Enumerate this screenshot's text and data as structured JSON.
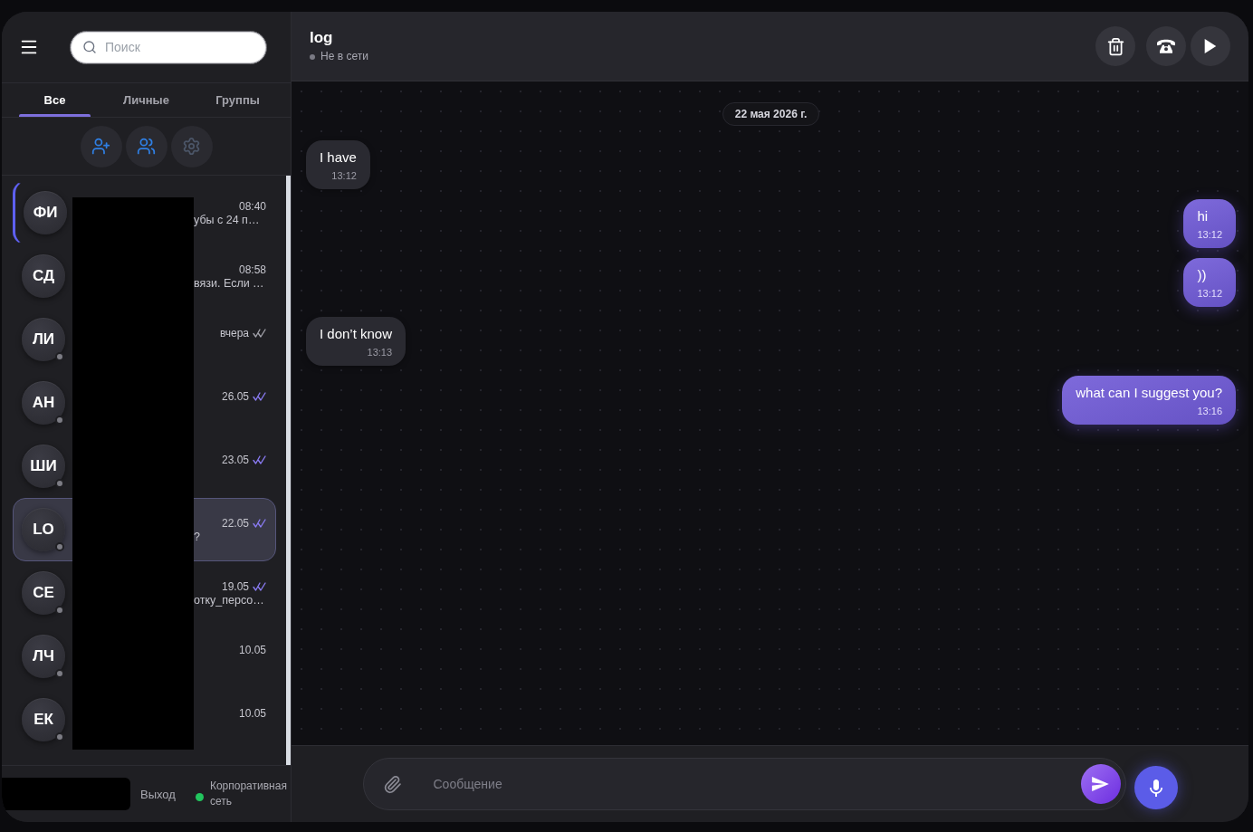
{
  "sidebar": {
    "search": {
      "placeholder": "Поиск"
    },
    "tabs": [
      {
        "label": "Все",
        "selected": true
      },
      {
        "label": "Личные",
        "selected": false
      },
      {
        "label": "Группы",
        "selected": false
      }
    ],
    "chats": [
      {
        "initials": "ФИ",
        "time": "08:40",
        "preview": "убы с 24 п…",
        "offline": false,
        "focused": true,
        "selected": false
      },
      {
        "initials": "СД",
        "time": "08:58",
        "preview": "вязи. Если …",
        "offline": false,
        "focused": false,
        "selected": false
      },
      {
        "initials": "ЛИ",
        "time": "вчера",
        "receipt": {
          "read": false
        },
        "offline": true,
        "focused": false,
        "selected": false
      },
      {
        "initials": "АН",
        "time": "26.05",
        "receipt": {
          "read": true
        },
        "offline": true,
        "focused": false,
        "selected": false
      },
      {
        "initials": "ШИ",
        "time": "23.05",
        "receipt": {
          "read": true
        },
        "offline": true,
        "focused": false,
        "selected": false
      },
      {
        "initials": "LO",
        "time": "22.05",
        "preview": "?",
        "receipt": {
          "read": true
        },
        "offline": true,
        "focused": false,
        "selected": true
      },
      {
        "initials": "СЕ",
        "time": "19.05",
        "preview": "отку_персо…",
        "receipt": {
          "read": true
        },
        "offline": true,
        "focused": false,
        "selected": false
      },
      {
        "initials": "ЛЧ",
        "time": "10.05",
        "offline": true,
        "focused": false,
        "selected": false
      },
      {
        "initials": "ЕК",
        "time": "10.05",
        "offline": true,
        "focused": false,
        "selected": false
      }
    ],
    "footer": {
      "logout": "Выход",
      "network": {
        "label": "Корпоративная сеть",
        "connected": true
      }
    }
  },
  "chat": {
    "title": "log",
    "status": {
      "label": "Не в сети",
      "online": false
    },
    "date": "22 мая 2026 г.",
    "messages": [
      {
        "text": "I have",
        "time": "13:12",
        "outgoing": false
      },
      {
        "text": "hi",
        "time": "13:12",
        "outgoing": true
      },
      {
        "text": "))",
        "time": "13:12",
        "outgoing": true
      },
      {
        "text": "I don’t know",
        "time": "13:13",
        "outgoing": false
      },
      {
        "text": "what can I suggest you?",
        "time": "13:16",
        "outgoing": true
      }
    ],
    "composer": {
      "placeholder": "Сообщение"
    }
  }
}
